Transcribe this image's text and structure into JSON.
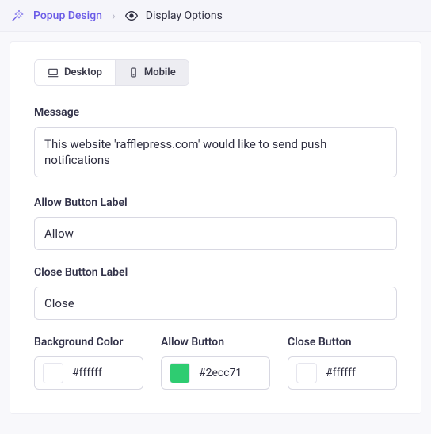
{
  "breadcrumb": {
    "parent": "Popup Design",
    "current": "Display Options"
  },
  "tabs": {
    "desktop": "Desktop",
    "mobile": "Mobile"
  },
  "fields": {
    "message": {
      "label": "Message",
      "value": "This website 'rafflepress.com' would like to send push notifications"
    },
    "allowLabel": {
      "label": "Allow Button Label",
      "value": "Allow"
    },
    "closeLabel": {
      "label": "Close Button Label",
      "value": "Close"
    }
  },
  "colors": {
    "background": {
      "label": "Background Color",
      "value": "#ffffff"
    },
    "allow": {
      "label": "Allow Button",
      "value": "#2ecc71"
    },
    "close": {
      "label": "Close Button",
      "value": "#ffffff"
    }
  }
}
